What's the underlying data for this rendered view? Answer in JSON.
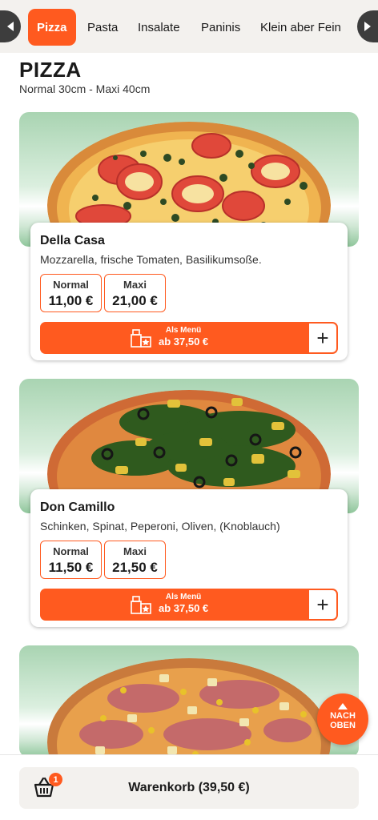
{
  "nav": {
    "categories": [
      "Pizza",
      "Pasta",
      "Insalate",
      "Paninis",
      "Klein aber Fein"
    ],
    "active_category": "Pizza",
    "left_arrow_icon": "chevron-left-icon",
    "right_arrow_icon": "chevron-right-icon"
  },
  "section": {
    "title": "PIZZA",
    "subtitle": "Normal 30cm - Maxi 40cm"
  },
  "products": [
    {
      "name": "Della Casa",
      "description": "Mozzarella, frische Tomaten, Basilikumsoße.",
      "prices": [
        {
          "label": "Normal",
          "value": "11,00 €"
        },
        {
          "label": "Maxi",
          "value": "21,00 €"
        }
      ],
      "menu_label": "Als Menü",
      "menu_price": "ab 37,50 €",
      "add_icon": "plus-icon"
    },
    {
      "name": "Don Camillo",
      "description": "Schinken, Spinat, Peperoni, Oliven, (Knoblauch)",
      "prices": [
        {
          "label": "Normal",
          "value": "11,50 €"
        },
        {
          "label": "Maxi",
          "value": "21,50 €"
        }
      ],
      "menu_label": "Als Menü",
      "menu_price": "ab 37,50 €",
      "add_icon": "plus-icon"
    }
  ],
  "back_to_top": {
    "line1": "NACH",
    "line2": "OBEN"
  },
  "cart": {
    "label": "Warenkorb (39,50 €)",
    "count": "1",
    "icon": "shopping-basket-icon"
  },
  "colors": {
    "accent": "#ff5a1f",
    "nav_bg": "#f3f1ee"
  }
}
